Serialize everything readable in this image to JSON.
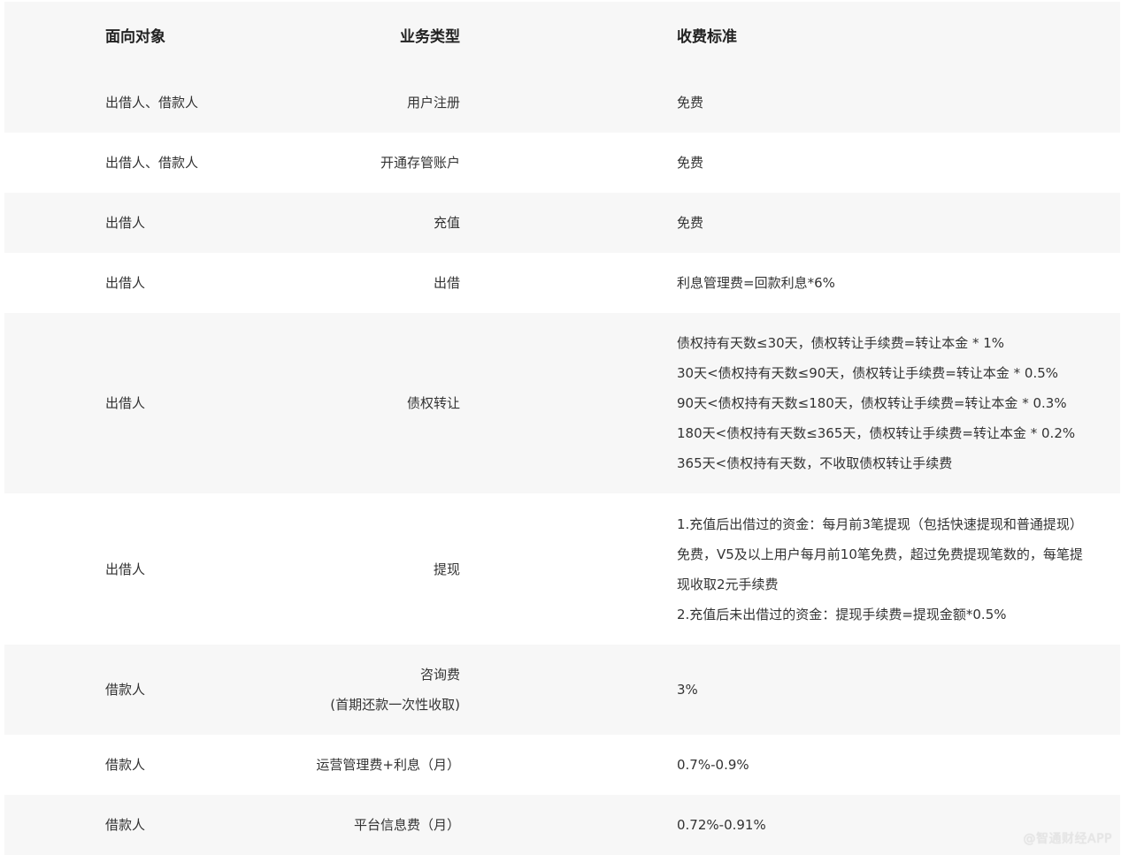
{
  "header": {
    "col_target": "面向对象",
    "col_type": "业务类型",
    "col_fee": "收费标准"
  },
  "rows": [
    {
      "target": "出借人、借款人",
      "type": [
        "用户注册"
      ],
      "fee": [
        "免费"
      ]
    },
    {
      "target": "出借人、借款人",
      "type": [
        "开通存管账户"
      ],
      "fee": [
        "免费"
      ]
    },
    {
      "target": "出借人",
      "type": [
        "充值"
      ],
      "fee": [
        "免费"
      ]
    },
    {
      "target": "出借人",
      "type": [
        "出借"
      ],
      "fee": [
        "利息管理费=回款利息*6%"
      ]
    },
    {
      "target": "出借人",
      "type": [
        "债权转让"
      ],
      "fee": [
        "债权持有天数≤30天，债权转让手续费=转让本金 * 1%",
        "30天<债权持有天数≤90天，债权转让手续费=转让本金 * 0.5%",
        "90天<债权持有天数≤180天，债权转让手续费=转让本金 * 0.3%",
        "180天<债权持有天数≤365天，债权转让手续费=转让本金 * 0.2%",
        "365天<债权持有天数，不收取债权转让手续费"
      ]
    },
    {
      "target": "出借人",
      "type": [
        "提现"
      ],
      "fee": [
        "1.充值后出借过的资金：每月前3笔提现（包括快速提现和普通提现）",
        "免费，V5及以上用户每月前10笔免费，超过免费提现笔数的，每笔提",
        "现收取2元手续费",
        "2.充值后未出借过的资金：提现手续费=提现金额*0.5%"
      ]
    },
    {
      "target": "借款人",
      "type": [
        "咨询费",
        "(首期还款一次性收取)"
      ],
      "fee": [
        "3%"
      ]
    },
    {
      "target": "借款人",
      "type": [
        "运营管理费+利息（月）"
      ],
      "fee": [
        "0.7%-0.9%"
      ]
    },
    {
      "target": "借款人",
      "type": [
        "平台信息费（月）"
      ],
      "fee": [
        "0.72%-0.91%"
      ]
    }
  ],
  "watermark": "@智通财经APP"
}
